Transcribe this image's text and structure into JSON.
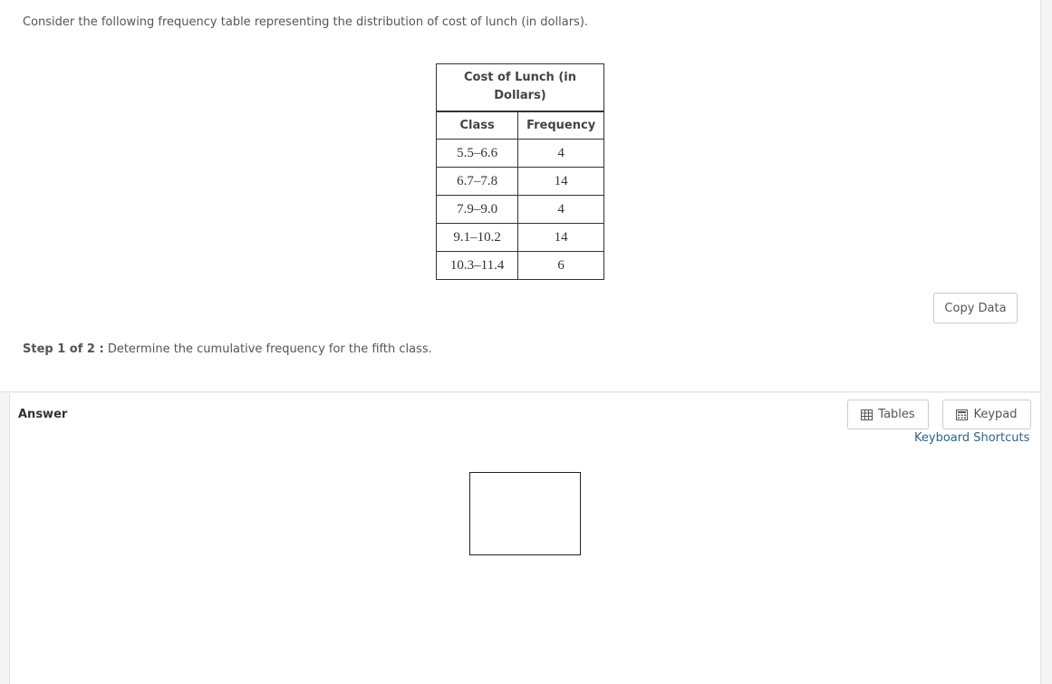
{
  "question": {
    "text": "Consider the following frequency table representing the distribution of cost of lunch (in dollars)."
  },
  "table": {
    "caption": "Cost of Lunch (in Dollars)",
    "headers": [
      "Class",
      "Frequency"
    ],
    "rows": [
      [
        "5.5–6.6",
        "4"
      ],
      [
        "6.7–7.8",
        "14"
      ],
      [
        "7.9–9.0",
        "4"
      ],
      [
        "9.1–10.2",
        "14"
      ],
      [
        "10.3–11.4",
        "6"
      ]
    ]
  },
  "copy_data_label": "Copy Data",
  "step": {
    "label": "Step 1 of 2 :",
    "text": "Determine the cumulative frequency for the fifth class."
  },
  "answer": {
    "label": "Answer",
    "value": ""
  },
  "toolbar": {
    "tables_label": "Tables",
    "keypad_label": "Keypad",
    "shortcuts_label": "Keyboard Shortcuts"
  }
}
